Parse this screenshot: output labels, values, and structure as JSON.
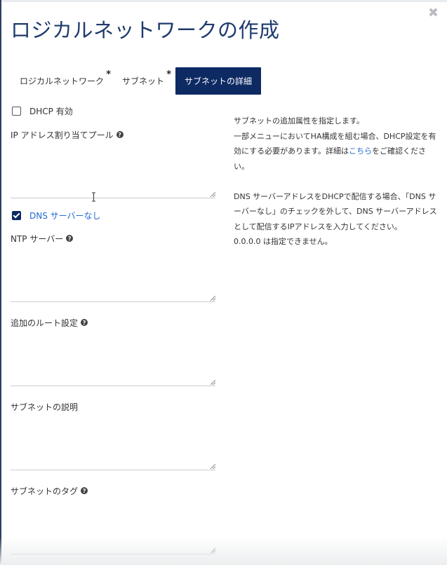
{
  "dialog": {
    "title": "ロジカルネットワークの作成",
    "close_icon": "close-icon"
  },
  "tabs": [
    {
      "label": "ロジカルネットワーク",
      "required": "*",
      "active": false
    },
    {
      "label": "サブネット",
      "required": "*",
      "active": false
    },
    {
      "label": "サブネットの詳細",
      "required": "",
      "active": true
    }
  ],
  "form": {
    "dhcp": {
      "label": "DHCP 有効",
      "checked": false
    },
    "ip_pool": {
      "label": "IP アドレス割り当てプール",
      "value": ""
    },
    "no_dns": {
      "label": "DNS サーバーなし",
      "checked": true
    },
    "ntp": {
      "label": "NTP サーバー",
      "value": ""
    },
    "routes": {
      "label": "追加のルート設定",
      "value": ""
    },
    "description": {
      "label": "サブネットの説明",
      "value": ""
    },
    "tags": {
      "label": "サブネットのタグ",
      "value": ""
    }
  },
  "help": {
    "line1": "サブネットの追加属性を指定します。",
    "line2_pre": "一部メニューにおいてHA構成を組む場合、DHCP設定を有効にする必要があります。詳細は",
    "link": "こちら",
    "line2_post": "をご確認ください。",
    "line3": "DNS サーバーアドレスをDHCPで配信する場合、「DNS サーバーなし」のチェックを外して、DNS サーバーアドレスとして配信するIPアドレスを入力してください。",
    "line4": "0.0.0.0 は指定できません。"
  },
  "colors": {
    "accent": "#0d2a63",
    "title": "#1f3a6e",
    "link": "#1f6ad0"
  }
}
